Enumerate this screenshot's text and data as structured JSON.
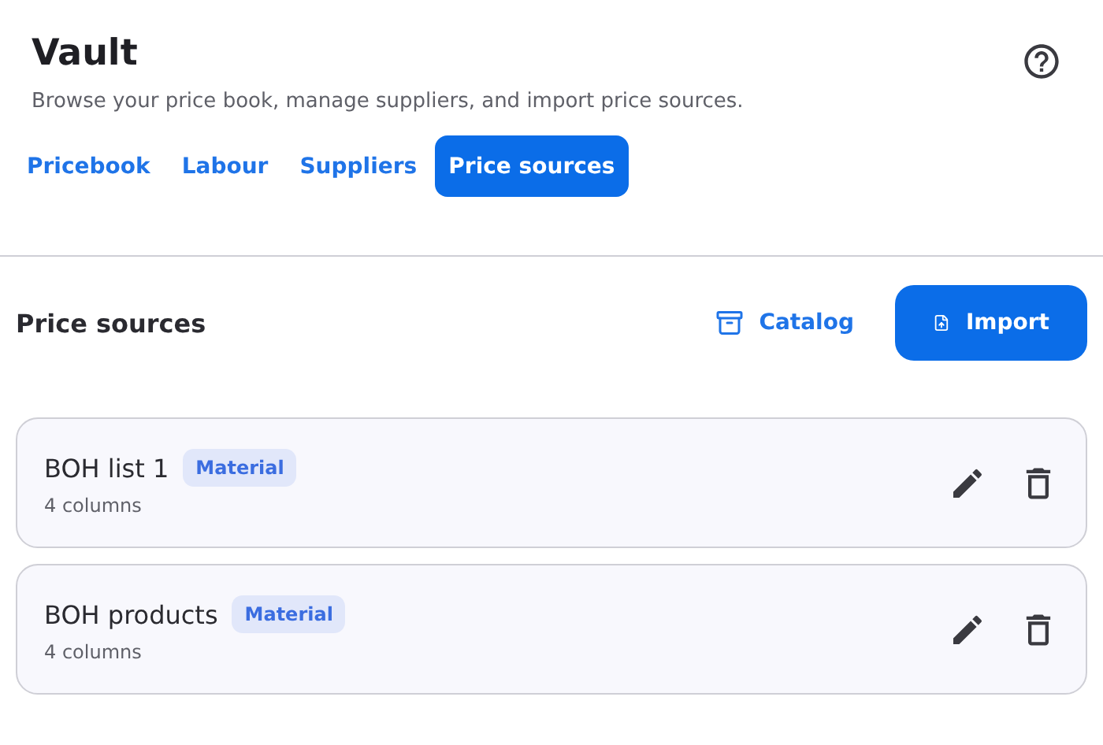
{
  "header": {
    "title": "Vault",
    "subtitle": "Browse your price book, manage suppliers, and import price sources."
  },
  "tabs": [
    {
      "label": "Pricebook",
      "selected": false
    },
    {
      "label": "Labour",
      "selected": false
    },
    {
      "label": "Suppliers",
      "selected": false
    },
    {
      "label": "Price sources",
      "selected": true
    }
  ],
  "section": {
    "title": "Price sources",
    "catalog_button": "Catalog",
    "import_button": "Import"
  },
  "sources": [
    {
      "name": "BOH list 1",
      "tag": "Material",
      "meta": "4 columns"
    },
    {
      "name": "BOH products",
      "tag": "Material",
      "meta": "4 columns"
    }
  ]
}
